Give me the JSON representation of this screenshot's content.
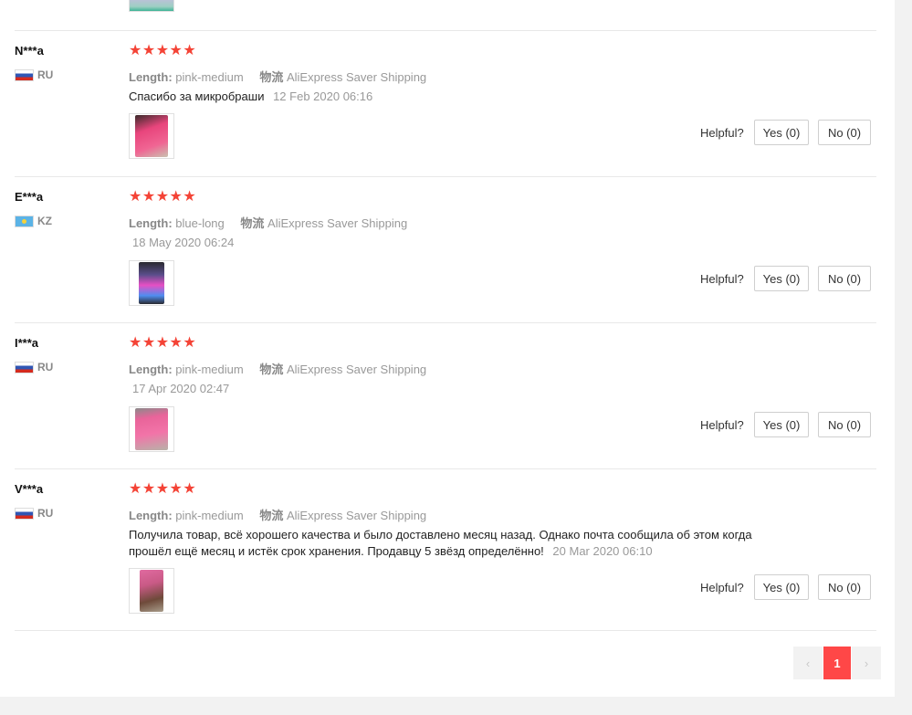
{
  "reviews": [
    {
      "user": "N***a",
      "country": "RU",
      "stars": "★★★★★",
      "length_label": "Length:",
      "length_value": "pink-medium",
      "shipping_label": "物流",
      "shipping_value": "AliExpress Saver Shipping",
      "text": "Спасибо за микробраши",
      "date": "12 Feb 2020 06:16",
      "helpful_label": "Helpful?",
      "yes_label": "Yes (0)",
      "no_label": "No (0)"
    },
    {
      "user": "E***a",
      "country": "KZ",
      "stars": "★★★★★",
      "length_label": "Length:",
      "length_value": "blue-long",
      "shipping_label": "物流",
      "shipping_value": "AliExpress Saver Shipping",
      "text": "",
      "date": "18 May 2020 06:24",
      "helpful_label": "Helpful?",
      "yes_label": "Yes (0)",
      "no_label": "No (0)"
    },
    {
      "user": "I***a",
      "country": "RU",
      "stars": "★★★★★",
      "length_label": "Length:",
      "length_value": "pink-medium",
      "shipping_label": "物流",
      "shipping_value": "AliExpress Saver Shipping",
      "text": "",
      "date": "17 Apr 2020 02:47",
      "helpful_label": "Helpful?",
      "yes_label": "Yes (0)",
      "no_label": "No (0)"
    },
    {
      "user": "V***a",
      "country": "RU",
      "stars": "★★★★★",
      "length_label": "Length:",
      "length_value": "pink-medium",
      "shipping_label": "物流",
      "shipping_value": "AliExpress Saver Shipping",
      "text": "Получила товар, всё хорошего качества и было доставлено месяц назад. Однако почта сообщила об этом когда прошёл ещё месяц и истёк срок хранения. Продавцу 5 звёзд определённо!",
      "date": "20 Mar 2020 06:10",
      "helpful_label": "Helpful?",
      "yes_label": "Yes (0)",
      "no_label": "No (0)"
    }
  ],
  "pagination": {
    "prev": "‹",
    "current": "1",
    "next": "›"
  },
  "colors": {
    "star": "#f44336",
    "pager_active": "#ff4747"
  }
}
